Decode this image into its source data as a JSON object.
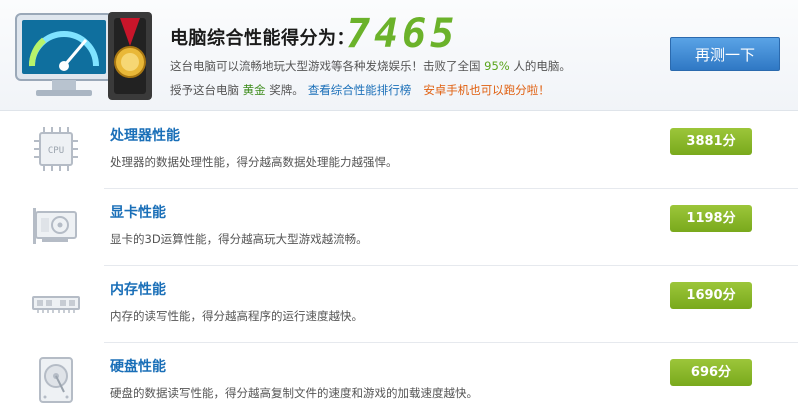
{
  "header": {
    "title": "电脑综合性能得分为：",
    "score": "7465",
    "line1_before": "这台电脑可以流畅地玩大型游戏等各种发烧娱乐！击败了全国 ",
    "line1_percent": "95%",
    "line1_after": " 人的电脑。",
    "line2_before": "授予这台电脑 ",
    "line2_medal": "黄金",
    "line2_after": " 奖牌。",
    "ranking_link": "查看综合性能排行榜",
    "android_text": "安卓手机也可以跑分啦！",
    "retest_label": "再测一下"
  },
  "items": [
    {
      "name": "处理器性能",
      "desc": "处理器的数据处理性能，得分越高数据处理能力越强悍。",
      "score": "3881分",
      "icon_label": "CPU"
    },
    {
      "name": "显卡性能",
      "desc": "显卡的3D运算性能，得分越高玩大型游戏越流畅。",
      "score": "1198分"
    },
    {
      "name": "内存性能",
      "desc": "内存的读写性能，得分越高程序的运行速度越快。",
      "score": "1690分"
    },
    {
      "name": "硬盘性能",
      "desc": "硬盘的数据读写性能，得分越高复制文件的速度和游戏的加载速度越快。",
      "score": "696分"
    }
  ],
  "colors": {
    "score_green": "#6bb22a",
    "link_blue": "#1a6fb8",
    "badge_green": "#86b424",
    "android_orange": "#e06010",
    "button_blue": "#3a86d2"
  }
}
